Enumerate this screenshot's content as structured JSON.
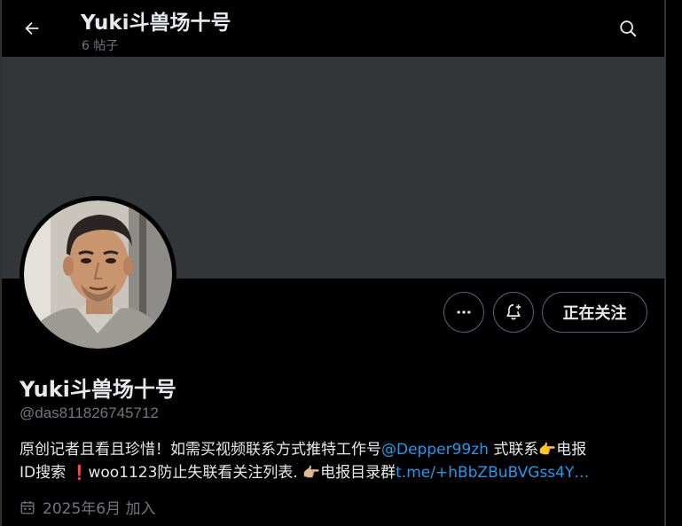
{
  "header": {
    "title": "Yuki斗兽场十号",
    "post_count": "6 帖子"
  },
  "profile": {
    "display_name": "Yuki斗兽场十号",
    "handle": "@das811826745712",
    "bio": {
      "seg1": "原创记者且看且珍惜！如需买视频联系方式推特工作号",
      "mention": "@Depper99zh",
      "seg2": " 式联系",
      "emoji1": "👉",
      "seg3": "电报",
      "seg4": "ID搜索 ",
      "emoji2": "❗",
      "seg5": "woo1123防止失联看关注列表. ",
      "emoji3": "👉🏼",
      "seg6": "电报目录群",
      "link": "t.me/+hBbZBuBVGss4Y…"
    },
    "joined": "2025年6月 加入"
  },
  "actions": {
    "more_icon": "more-dots-icon",
    "bell_icon": "bell-plus-icon",
    "follow_label": "正在关注"
  },
  "colors": {
    "background": "#000000",
    "banner": "#333639",
    "text_primary": "#e7e9ea",
    "text_secondary": "#71767b",
    "link": "#1d9bf0",
    "button_border": "#536471"
  }
}
